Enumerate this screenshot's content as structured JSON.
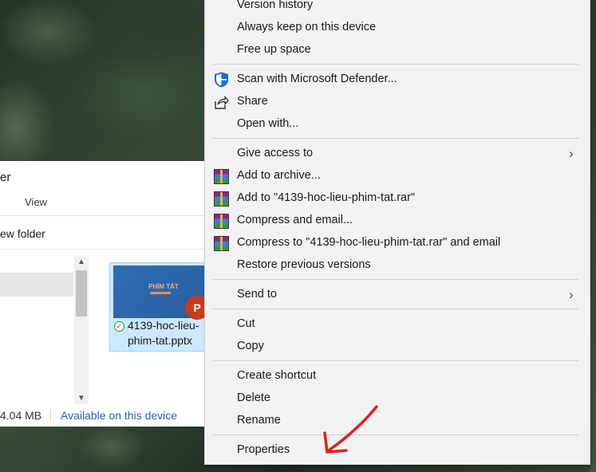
{
  "explorer": {
    "title_fragment": "er",
    "view_tab": "View",
    "new_folder_fragment": "ew folder",
    "file": {
      "name_line1": "4139-hoc-lieu-",
      "name_line2": "phim-tat.pptx",
      "thumbnail_title": "PHÍM TẮT",
      "app_badge": "P"
    },
    "status": {
      "size_fragment": "4.04 MB",
      "availability": "Available on this device"
    },
    "scroll_up": "▲",
    "scroll_down": "▼"
  },
  "context_menu": {
    "items": [
      {
        "label": "Version history"
      },
      {
        "label": "Always keep on this device"
      },
      {
        "label": "Free up space"
      },
      {
        "label": "Scan with Microsoft Defender...",
        "icon": "defender-shield-icon"
      },
      {
        "label": "Share",
        "icon": "share-icon"
      },
      {
        "label": "Open with..."
      },
      {
        "label": "Give access to",
        "submenu": true
      },
      {
        "label": "Add to archive...",
        "icon": "winrar-icon"
      },
      {
        "label": "Add to \"4139-hoc-lieu-phim-tat.rar\"",
        "icon": "winrar-icon"
      },
      {
        "label": "Compress and email...",
        "icon": "winrar-icon"
      },
      {
        "label": "Compress to \"4139-hoc-lieu-phim-tat.rar\" and email",
        "icon": "winrar-icon"
      },
      {
        "label": "Restore previous versions"
      },
      {
        "label": "Send to",
        "submenu": true
      },
      {
        "label": "Cut"
      },
      {
        "label": "Copy"
      },
      {
        "label": "Create shortcut"
      },
      {
        "label": "Delete"
      },
      {
        "label": "Rename"
      },
      {
        "label": "Properties"
      }
    ],
    "submenu_arrow": "›"
  },
  "colors": {
    "menu_bg": "#f2f2f2",
    "selection_bg": "#cce8ff",
    "link_blue": "#2a5da8",
    "annotation_red": "#e02020"
  }
}
